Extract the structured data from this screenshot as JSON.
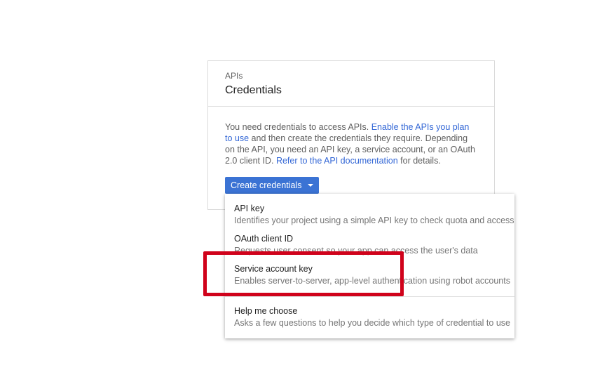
{
  "card": {
    "subtitle": "APIs",
    "title": "Credentials",
    "body": {
      "text1": "You need credentials to access APIs. ",
      "link1": "Enable the APIs you plan to use",
      "text2": " and then create the credentials they require. Depending on the API, you need an API key, a service account, or an OAuth 2.0 client ID. ",
      "link2": "Refer to the API documentation",
      "text3": " for details."
    },
    "create_button_label": "Create credentials"
  },
  "menu": {
    "items": [
      {
        "title": "API key",
        "description": "Identifies your project using a simple API key to check quota and access"
      },
      {
        "title": "OAuth client ID",
        "description": "Requests user consent so your app can access the user's data"
      },
      {
        "title": "Service account key",
        "description": "Enables server-to-server, app-level authentication using robot accounts"
      },
      {
        "title": "Help me choose",
        "description": "Asks a few questions to help you decide which type of credential to use"
      }
    ]
  },
  "colors": {
    "accent": "#3b73d4",
    "link": "#3367d6",
    "highlight": "#d0021b"
  }
}
